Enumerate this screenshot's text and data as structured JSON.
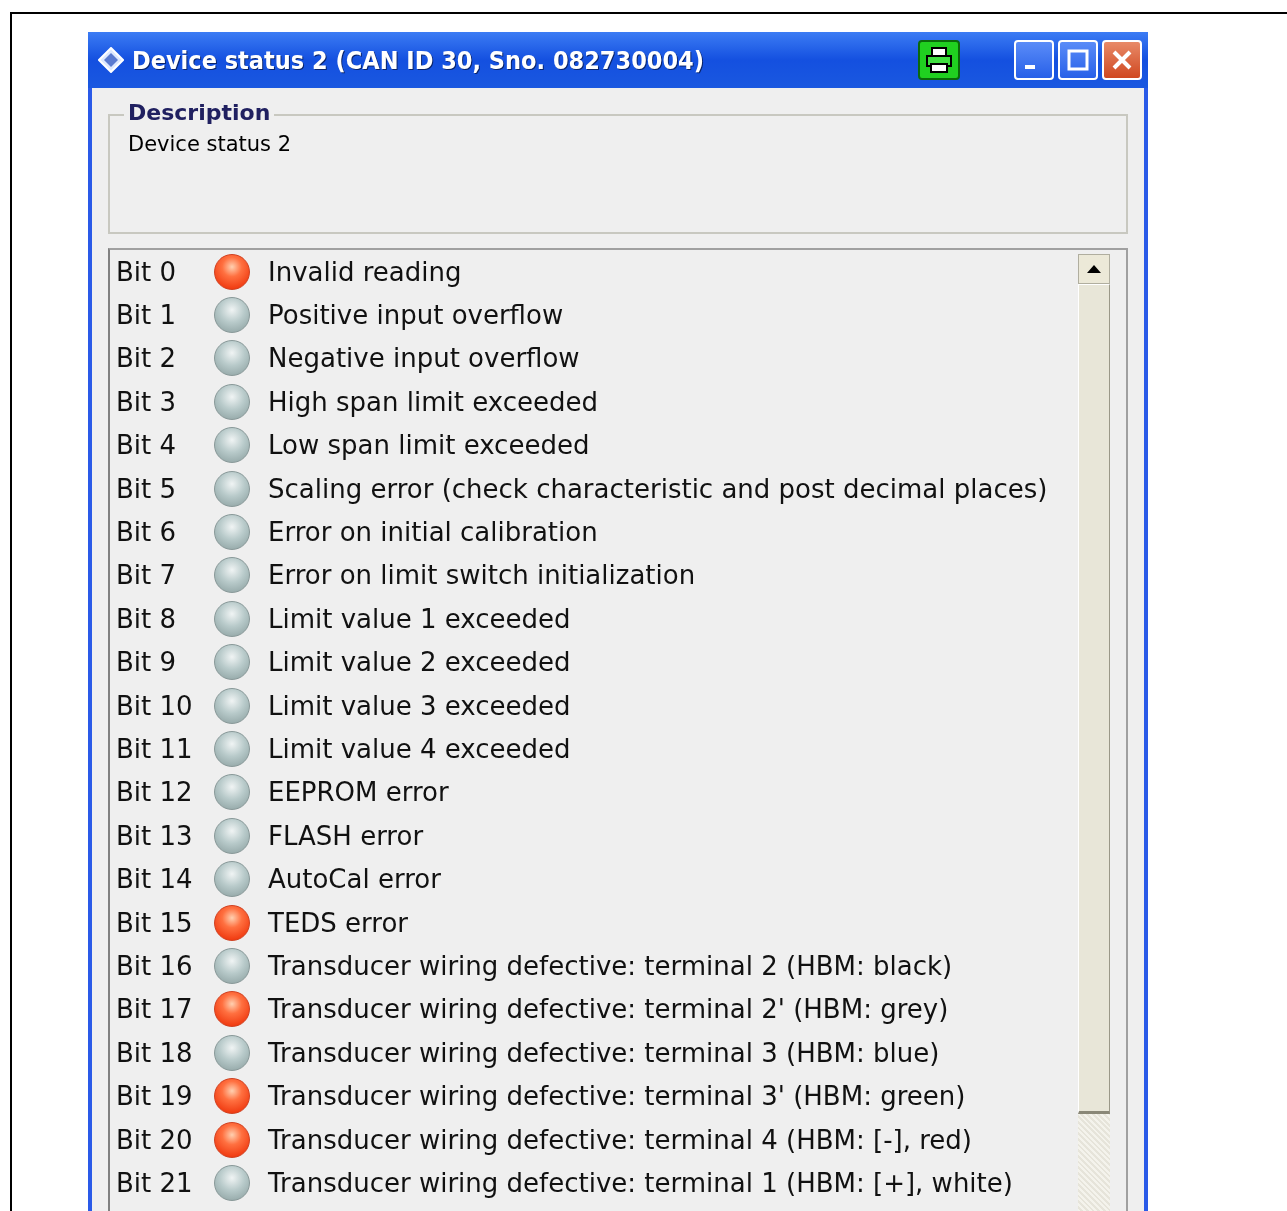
{
  "window": {
    "title": "Device status 2 (CAN ID 30, Sno. 082730004)"
  },
  "description": {
    "legend": "Description",
    "text": "Device status 2"
  },
  "bits": [
    {
      "label": "Bit 0",
      "text": "Invalid reading",
      "active": true
    },
    {
      "label": "Bit 1",
      "text": "Positive input overflow",
      "active": false
    },
    {
      "label": "Bit 2",
      "text": "Negative input overflow",
      "active": false
    },
    {
      "label": "Bit 3",
      "text": "High span limit exceeded",
      "active": false
    },
    {
      "label": "Bit 4",
      "text": "Low span limit exceeded",
      "active": false
    },
    {
      "label": "Bit 5",
      "text": "Scaling error (check characteristic and post decimal places)",
      "active": false
    },
    {
      "label": "Bit 6",
      "text": "Error on initial calibration",
      "active": false
    },
    {
      "label": "Bit 7",
      "text": "Error on limit switch initialization",
      "active": false
    },
    {
      "label": "Bit 8",
      "text": "Limit value 1 exceeded",
      "active": false
    },
    {
      "label": "Bit 9",
      "text": "Limit value 2 exceeded",
      "active": false
    },
    {
      "label": "Bit 10",
      "text": "Limit value 3 exceeded",
      "active": false
    },
    {
      "label": "Bit 11",
      "text": "Limit value 4 exceeded",
      "active": false
    },
    {
      "label": "Bit 12",
      "text": "EEPROM error",
      "active": false
    },
    {
      "label": "Bit 13",
      "text": "FLASH error",
      "active": false
    },
    {
      "label": "Bit 14",
      "text": "AutoCal error",
      "active": false
    },
    {
      "label": "Bit 15",
      "text": "TEDS error",
      "active": true
    },
    {
      "label": "Bit 16",
      "text": "Transducer wiring defective: terminal 2 (HBM: black)",
      "active": false
    },
    {
      "label": "Bit 17",
      "text": "Transducer wiring defective: terminal 2' (HBM: grey)",
      "active": true
    },
    {
      "label": "Bit 18",
      "text": "Transducer wiring defective: terminal 3 (HBM: blue)",
      "active": false
    },
    {
      "label": "Bit 19",
      "text": "Transducer wiring defective: terminal 3' (HBM: green)",
      "active": true
    },
    {
      "label": "Bit 20",
      "text": "Transducer wiring defective: terminal 4 (HBM: [-], red)",
      "active": true
    },
    {
      "label": "Bit 21",
      "text": "Transducer wiring defective: terminal 1 (HBM: [+], white)",
      "active": false
    }
  ]
}
